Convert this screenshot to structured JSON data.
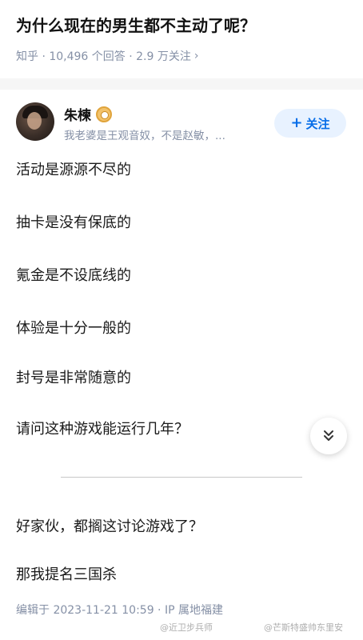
{
  "question": {
    "title": "为什么现在的男生都不主动了呢？",
    "meta": "知乎 · 10,496 个回答 · 2.9 万关注",
    "meta_arrow": "›"
  },
  "author": {
    "name": "朱楝",
    "bio": "我老婆是王观音奴，不是赵敏，...",
    "follow_label": "关注",
    "follow_plus": "+"
  },
  "answer": {
    "lines": [
      "活动是源源不尽的",
      "抽卡是没有保底的",
      "氪金是不设底线的",
      "体验是十分一般的",
      "封号是非常随意的",
      "请问这种游戏能运行几年？",
      "好家伙，都搁这讨论游戏了？",
      "那我提名三国杀"
    ],
    "edit_meta": "编辑于 2023-11-21 10:59 · IP 属地福建"
  },
  "watermarks": [
    "@近卫步兵师",
    "@芒斯特盛帅东里安"
  ],
  "colors": {
    "accent": "#056de8",
    "follow_bg": "#e8f2ff",
    "meta_gray": "#8590a6"
  }
}
